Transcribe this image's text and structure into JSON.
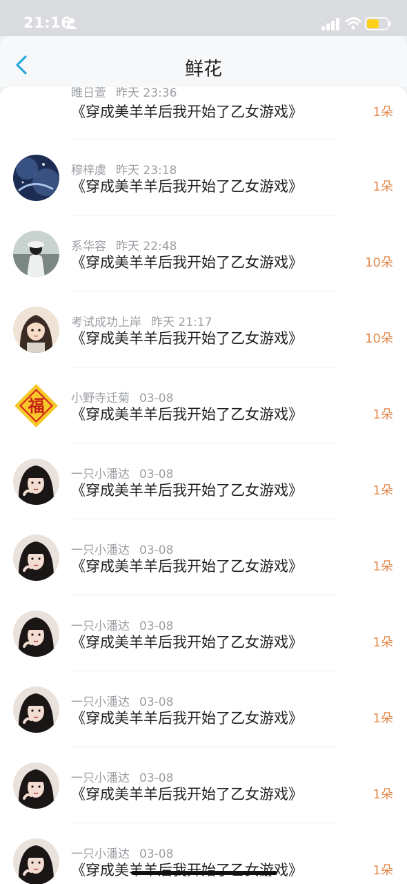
{
  "status_bar": {
    "time": "21:16"
  },
  "nav": {
    "title": "鲜花"
  },
  "colors": {
    "accent": "#29a6e0",
    "count": "#e38a4f",
    "battery": "#ffd21a"
  },
  "items": [
    {
      "user": "睢日萱",
      "time": "昨天 23:36",
      "book": "《穿成美羊羊后我开始了乙女游戏》",
      "count": "1朵",
      "avatar": "none"
    },
    {
      "user": "穆梓虞",
      "time": "昨天 23:18",
      "book": "《穿成美羊羊后我开始了乙女游戏》",
      "count": "1朵",
      "avatar": "night-sky"
    },
    {
      "user": "系华容",
      "time": "昨天 22:48",
      "book": "《穿成美羊羊后我开始了乙女游戏》",
      "count": "10朵",
      "avatar": "girl-outdoor"
    },
    {
      "user": "考试成功上岸",
      "time": "昨天 21:17",
      "book": "《穿成美羊羊后我开始了乙女游戏》",
      "count": "10朵",
      "avatar": "anime-girl"
    },
    {
      "user": "小野寺迁菊",
      "time": "03-08",
      "book": "《穿成美羊羊后我开始了乙女游戏》",
      "count": "1朵",
      "avatar": "fu-sign"
    },
    {
      "user": "一只小潘达",
      "time": "03-08",
      "book": "《穿成美羊羊后我开始了乙女游戏》",
      "count": "1朵",
      "avatar": "dark-hair-girl"
    },
    {
      "user": "一只小潘达",
      "time": "03-08",
      "book": "《穿成美羊羊后我开始了乙女游戏》",
      "count": "1朵",
      "avatar": "dark-hair-girl"
    },
    {
      "user": "一只小潘达",
      "time": "03-08",
      "book": "《穿成美羊羊后我开始了乙女游戏》",
      "count": "1朵",
      "avatar": "dark-hair-girl"
    },
    {
      "user": "一只小潘达",
      "time": "03-08",
      "book": "《穿成美羊羊后我开始了乙女游戏》",
      "count": "1朵",
      "avatar": "dark-hair-girl"
    },
    {
      "user": "一只小潘达",
      "time": "03-08",
      "book": "《穿成美羊羊后我开始了乙女游戏》",
      "count": "1朵",
      "avatar": "dark-hair-girl"
    },
    {
      "user": "一只小潘达",
      "time": "03-08",
      "book": "《穿成美羊羊后我开始了乙女游戏》",
      "count": "1朵",
      "avatar": "dark-hair-girl"
    }
  ]
}
